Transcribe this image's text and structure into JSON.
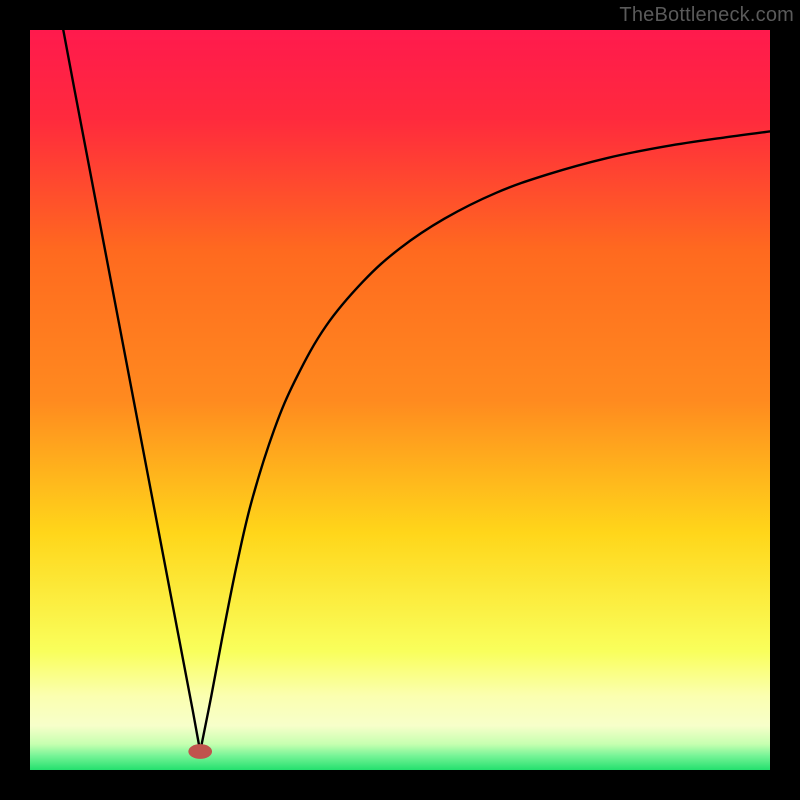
{
  "watermark": "TheBottleneck.com",
  "chart_data": {
    "type": "line",
    "title": "",
    "xlabel": "",
    "ylabel": "",
    "xlim": [
      0,
      100
    ],
    "ylim": [
      0,
      100
    ],
    "grid": false,
    "legend": false,
    "annotations": [],
    "background_gradient": {
      "top": "#ff1a4d",
      "upper_mid": "#ff8a1f",
      "mid": "#ffd61a",
      "lower_mid": "#f9ff5c",
      "band": "#fbffb0",
      "bottom": "#24e06e"
    },
    "marker": {
      "x": 23,
      "y": 2.5,
      "color": "#c0544d",
      "rx": 1.6,
      "ry": 1.0
    },
    "series": [
      {
        "name": "left-branch",
        "x": [
          4.5,
          6.0,
          8.0,
          10.0,
          12.0,
          14.0,
          16.0,
          18.0,
          20.0,
          22.0,
          23.0
        ],
        "y": [
          100.0,
          92.0,
          81.5,
          71.0,
          60.5,
          50.0,
          39.5,
          29.0,
          18.5,
          8.0,
          2.5
        ]
      },
      {
        "name": "right-branch",
        "x": [
          23.0,
          24.5,
          26.0,
          28.0,
          30.0,
          33.0,
          36.0,
          40.0,
          45.0,
          50.0,
          56.0,
          63.0,
          70.0,
          78.0,
          86.0,
          94.0,
          100.0
        ],
        "y": [
          2.5,
          10.0,
          18.0,
          28.0,
          36.5,
          46.0,
          53.0,
          60.0,
          66.0,
          70.5,
          74.5,
          78.0,
          80.5,
          82.7,
          84.3,
          85.5,
          86.3
        ]
      }
    ]
  }
}
